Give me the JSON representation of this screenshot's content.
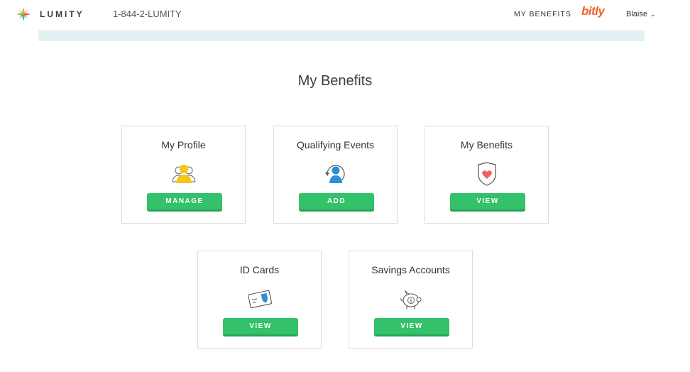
{
  "header": {
    "logo_text": "LUMITY",
    "phone": "1-844-2-LUMITY",
    "nav_benefits": "MY BENEFITS",
    "bitly": "bitly",
    "user_name": "Blaise",
    "user_chevron": "⌄"
  },
  "main": {
    "title": "My Benefits",
    "cards": [
      {
        "title": "My Profile",
        "button": "MANAGE",
        "icon": "profile-people-icon"
      },
      {
        "title": "Qualifying Events",
        "button": "ADD",
        "icon": "person-refresh-icon"
      },
      {
        "title": "My Benefits",
        "button": "VIEW",
        "icon": "heart-shield-icon"
      },
      {
        "title": "ID Cards",
        "button": "VIEW",
        "icon": "id-card-icon"
      },
      {
        "title": "Savings Accounts",
        "button": "VIEW",
        "icon": "piggy-bank-icon"
      }
    ]
  },
  "colors": {
    "button_green": "#33c16a",
    "banner": "#e2f2f3",
    "bitly_orange": "#ee6123"
  }
}
